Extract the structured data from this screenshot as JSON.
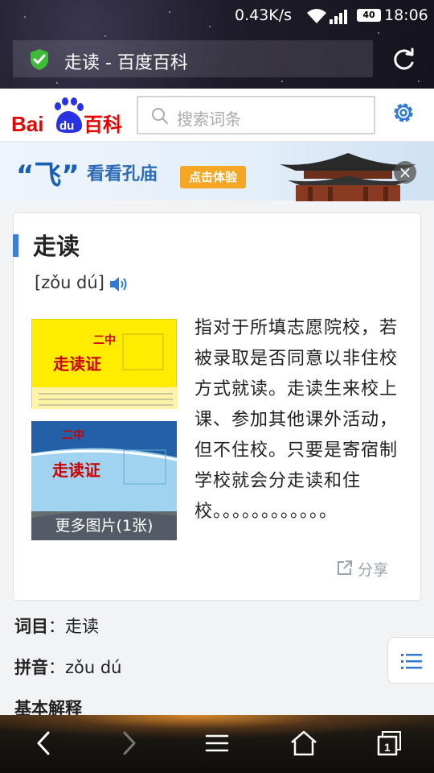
{
  "status_bar": {
    "speed": "0.43K/s",
    "battery": "40",
    "time": "18:06"
  },
  "browser": {
    "tab_title": "走读 - 百度百科"
  },
  "header": {
    "logo_text": "Bai du 百科",
    "search_placeholder": "搜索词条"
  },
  "banner": {
    "quote_text": "“飞”",
    "text": "看看孔庙",
    "button_label": "点击体验",
    "close_label": "×"
  },
  "entry": {
    "title": "走读",
    "pinyin": "[zǒu dú]",
    "image1_title": "二中",
    "image1_caption": "走读证",
    "image2_title": "二中",
    "image2_caption": "走读证",
    "more_pictures": "更多图片(1张)",
    "description": "指对于所填志愿院校，若被录取是否同意以非住校方式就读。走读生来校上课、参加其他课外活动，但不住校。只要是寄宿制学校就会分走读和住校。。。。。。。。。。。。",
    "share_label": "分享"
  },
  "fields": {
    "term_label": "词目",
    "term_value": "走读",
    "pinyin_label": "拼音",
    "pinyin_value": "zǒu dú",
    "section_heading": "基本解释"
  },
  "colors": {
    "brand_blue": "#2d6bb8",
    "accent_blue": "#3b7ddd",
    "banner_button": "#f5a623",
    "shield_green": "#3fba3a",
    "logo_red": "#e10601"
  },
  "icons": [
    "shield-check-icon",
    "reload-icon",
    "search-icon",
    "gear-icon",
    "speaker-icon",
    "share-icon",
    "list-icon",
    "back-icon",
    "forward-icon",
    "menu-icon",
    "home-icon",
    "tabs-icon"
  ],
  "nav": {
    "tabs_count": "1"
  }
}
